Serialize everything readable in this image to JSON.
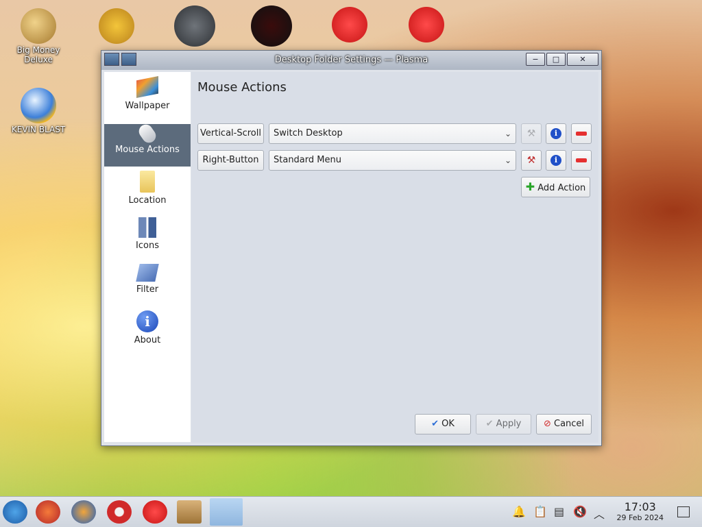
{
  "desktop": {
    "icons": [
      {
        "label": "Big Money\nDeluxe",
        "color": "#c8a35a"
      },
      {
        "label": "KEVIN BLAST",
        "color": "#4a8fe0"
      }
    ]
  },
  "window": {
    "title": "Desktop Folder Settings — Plasma",
    "minimize_glyph": "−",
    "maximize_glyph": "□",
    "close_glyph": "✕"
  },
  "sidebar": {
    "items": [
      {
        "label": "Wallpaper",
        "icon": "wallpaper-icon"
      },
      {
        "label": "Mouse Actions",
        "icon": "mouse-icon"
      },
      {
        "label": "Location",
        "icon": "folder-icon"
      },
      {
        "label": "Icons",
        "icon": "icons-icon"
      },
      {
        "label": "Filter",
        "icon": "filter-icon"
      },
      {
        "label": "About",
        "icon": "info-icon"
      }
    ]
  },
  "content": {
    "title": "Mouse Actions",
    "actions": [
      {
        "trigger": "Vertical-Scroll",
        "plugin": "Switch Desktop",
        "configure_enabled": false
      },
      {
        "trigger": "Right-Button",
        "plugin": "Standard Menu",
        "configure_enabled": true
      }
    ],
    "add_action_label": "Add Action",
    "ok_label": "OK",
    "apply_label": "Apply",
    "cancel_label": "Cancel"
  },
  "taskbar": {
    "time": "17:03",
    "date": "29 Feb 2024"
  },
  "colors": {
    "active_sidebar": "#5c6b7c",
    "accent": "#2050c8",
    "remove": "#e53030"
  }
}
